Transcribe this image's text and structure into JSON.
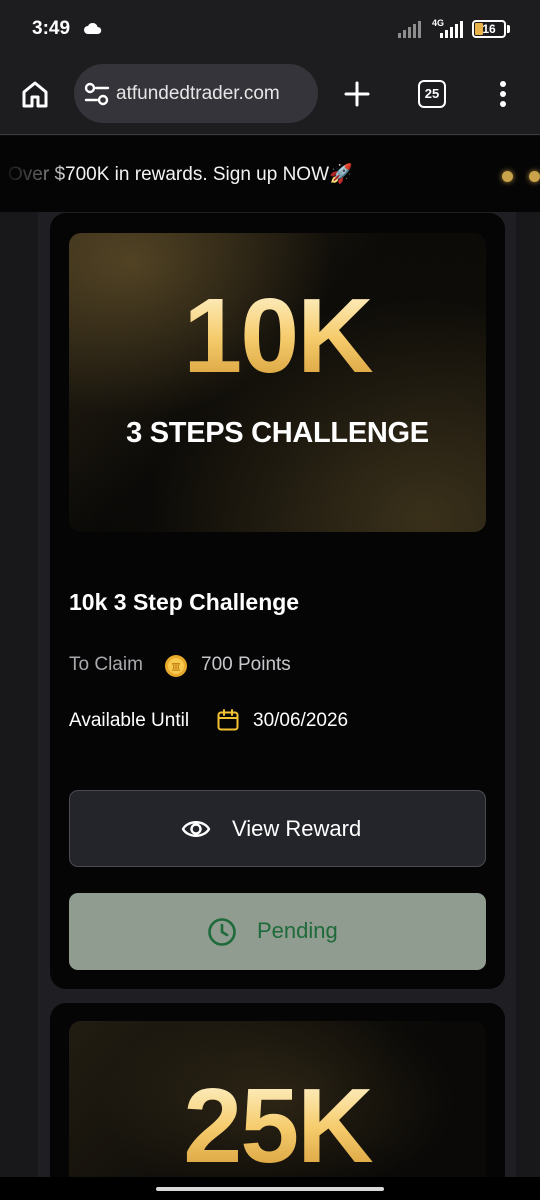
{
  "status_bar": {
    "time": "3:49",
    "network": "4G",
    "battery": "16"
  },
  "toolbar": {
    "url": "atfundedtrader.com",
    "tab_count": "25"
  },
  "banner": {
    "text": "Over $700K in rewards. Sign up NOW🚀"
  },
  "reward_card": {
    "hero_amount": "10K",
    "hero_subtitle": "3 STEPS CHALLENGE",
    "title": "10k 3 Step Challenge",
    "claim_label": "To Claim",
    "points": "700 Points",
    "available_label": "Available Until",
    "available_date": "30/06/2026",
    "view_button": "View Reward",
    "status_button": "Pending"
  },
  "next_card": {
    "hero_amount": "25K"
  },
  "colors": {
    "gold": "#f6cd6f",
    "pending_bg": "#8f9c8f",
    "pending_text": "#1f6a3a"
  }
}
